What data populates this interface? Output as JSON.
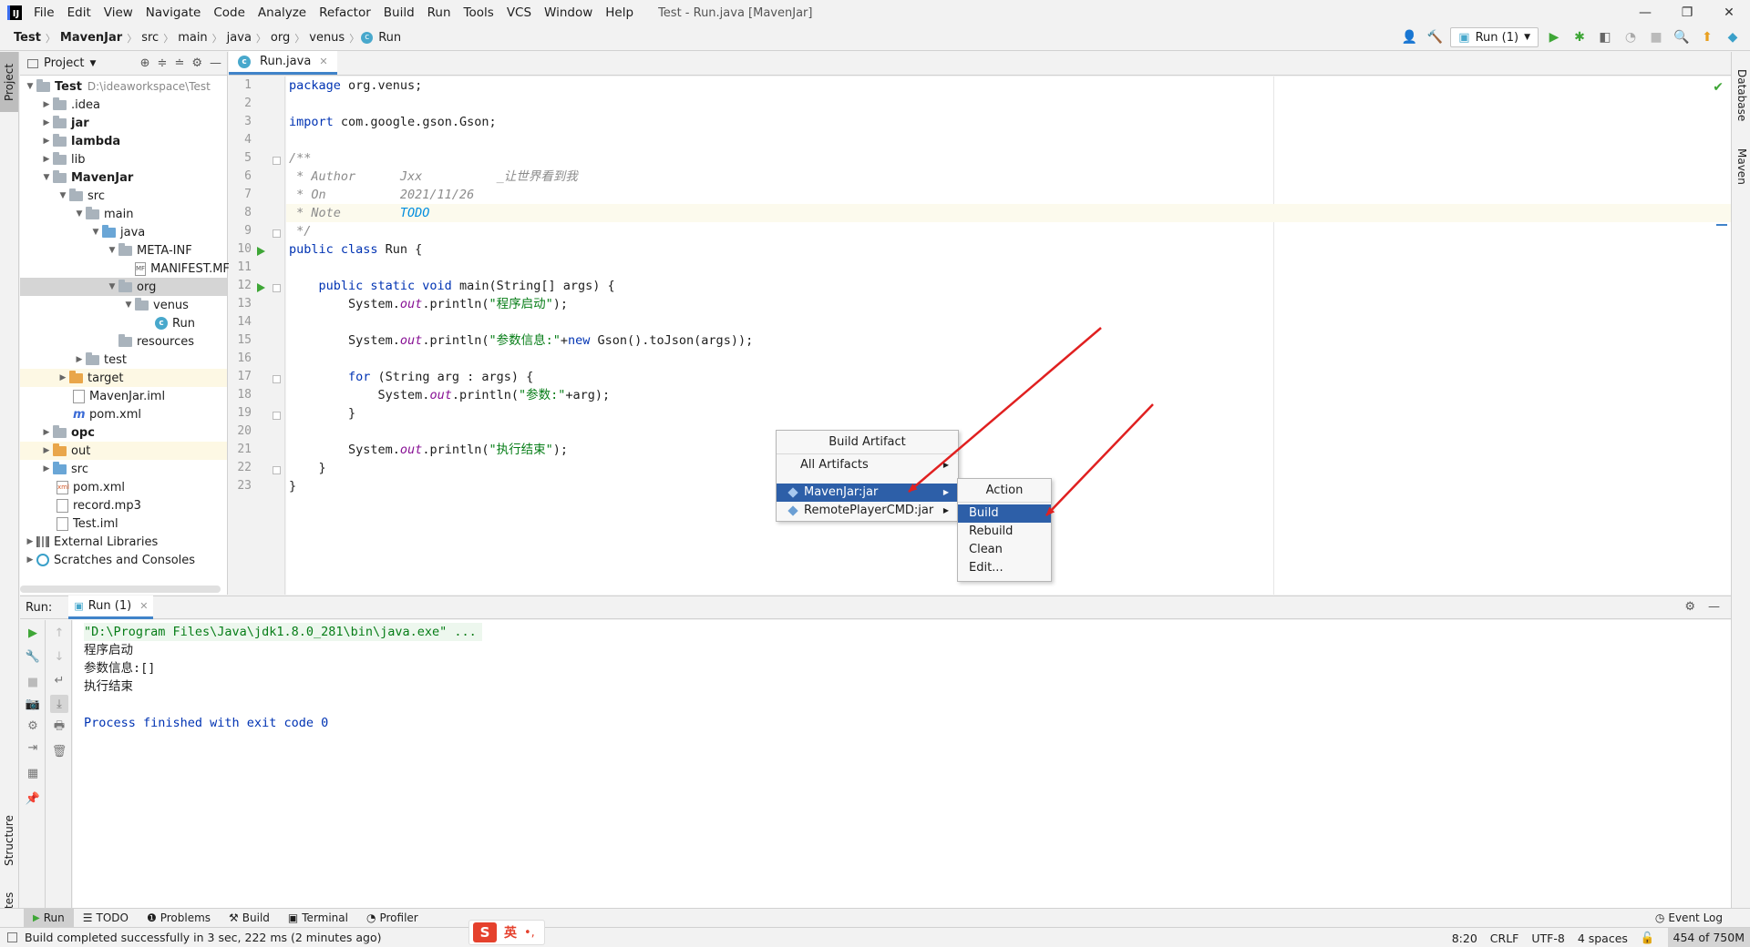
{
  "menubar": {
    "logo": "IJ",
    "items": [
      "File",
      "Edit",
      "View",
      "Navigate",
      "Code",
      "Analyze",
      "Refactor",
      "Build",
      "Run",
      "Tools",
      "VCS",
      "Window",
      "Help"
    ],
    "title": "Test - Run.java [MavenJar]",
    "controls": {
      "minimize": "—",
      "maximize": "❐",
      "close": "✕"
    }
  },
  "navbar": {
    "breadcrumb": [
      "Test",
      "MavenJar",
      "src",
      "main",
      "java",
      "org",
      "venus",
      "Run"
    ],
    "run_config": "Run (1)"
  },
  "left_strip": {
    "project": "Project",
    "structure": "Structure",
    "favorites": "Favorites"
  },
  "right_strip": {
    "database": "Database",
    "maven": "Maven"
  },
  "project_panel": {
    "title": "Project",
    "tree": [
      {
        "label": "Test",
        "path": "D:\\ideaworkspace\\Test"
      },
      {
        "label": ".idea"
      },
      {
        "label": "jar"
      },
      {
        "label": "lambda"
      },
      {
        "label": "lib"
      },
      {
        "label": "MavenJar"
      },
      {
        "label": "src"
      },
      {
        "label": "main"
      },
      {
        "label": "java"
      },
      {
        "label": "META-INF"
      },
      {
        "label": "MANIFEST.MF",
        "icon": "MF"
      },
      {
        "label": "org"
      },
      {
        "label": "venus"
      },
      {
        "label": "Run",
        "icon": "c"
      },
      {
        "label": "resources"
      },
      {
        "label": "test"
      },
      {
        "label": "target"
      },
      {
        "label": "MavenJar.iml"
      },
      {
        "label": "pom.xml",
        "icon": "m"
      },
      {
        "label": "opc"
      },
      {
        "label": "out"
      },
      {
        "label": "src"
      },
      {
        "label": "pom.xml",
        "icon": "xml"
      },
      {
        "label": "record.mp3"
      },
      {
        "label": "Test.iml"
      },
      {
        "label": "External Libraries"
      },
      {
        "label": "Scratches and Consoles"
      }
    ]
  },
  "editor": {
    "tab": "Run.java",
    "tab_icon": "c",
    "line_numbers": [
      "1",
      "2",
      "3",
      "4",
      "5",
      "6",
      "7",
      "8",
      "9",
      "10",
      "11",
      "12",
      "13",
      "14",
      "15",
      "16",
      "17",
      "18",
      "19",
      "20",
      "21",
      "22",
      "23"
    ],
    "code": {
      "l1_kw": "package",
      "l1_rest": " org.venus;",
      "l3_kw": "import",
      "l3_rest": " com.google.gson.Gson;",
      "l5": "/**",
      "l6_a": " * Author      Jxx          ",
      "l6_b": "_让世界看到我",
      "l7": " * On          2021/11/26",
      "l8_a": " * Note        ",
      "l8_b": "TODO",
      "l9": " */",
      "l10_kw": "public class",
      "l10_rest": " Run {",
      "l12_indent": "    ",
      "l12_kw": "public static void",
      "l12_rest": " main(String[] args) {",
      "l13_a": "        System.",
      "l13_out": "out",
      "l13_b": ".println(",
      "l13_str": "\"程序启动\"",
      "l13_c": ");",
      "l15_a": "        System.",
      "l15_out": "out",
      "l15_b": ".println(",
      "l15_str": "\"参数信息:\"",
      "l15_c": "+",
      "l15_kw": "new",
      "l15_d": " Gson().toJson(args));",
      "l17_indent": "        ",
      "l17_kw": "for",
      "l17_rest": " (String arg : args) {",
      "l18_a": "            System.",
      "l18_out": "out",
      "l18_b": ".println(",
      "l18_str": "\"参数:\"",
      "l18_c": "+arg);",
      "l19": "        }",
      "l21_a": "        System.",
      "l21_out": "out",
      "l21_b": ".println(",
      "l21_str": "\"执行结束\"",
      "l21_c": ");",
      "l22": "    }",
      "l23": "}"
    }
  },
  "build_artifact_popup": {
    "title": "Build Artifact",
    "items": [
      "All Artifacts",
      "MavenJar:jar",
      "RemotePlayerCMD:jar"
    ]
  },
  "action_popup": {
    "title": "Action",
    "items": [
      "Build",
      "Rebuild",
      "Clean",
      "Edit..."
    ]
  },
  "run_panel": {
    "label": "Run:",
    "tab": "Run (1)",
    "console": [
      "\"D:\\Program Files\\Java\\jdk1.8.0_281\\bin\\java.exe\" ...",
      "程序启动",
      "参数信息:[]",
      "执行结束",
      "",
      "Process finished with exit code 0"
    ]
  },
  "bottom_tabs": [
    "Run",
    "TODO",
    "Problems",
    "Build",
    "Terminal",
    "Profiler"
  ],
  "event_log": "Event Log",
  "status": {
    "message": "Build completed successfully in 3 sec, 222 ms (2 minutes ago)",
    "position": "8:20",
    "line_sep": "CRLF",
    "encoding": "UTF-8",
    "indent": "4 spaces",
    "memory": "454 of 750M"
  },
  "ime": {
    "logo": "S",
    "lang": "英",
    "punct": "•,"
  },
  "colors": {
    "accent": "#4083c9",
    "selection": "#2d5fa8",
    "arrow": "#e02020",
    "run_green": "#3ea636"
  }
}
